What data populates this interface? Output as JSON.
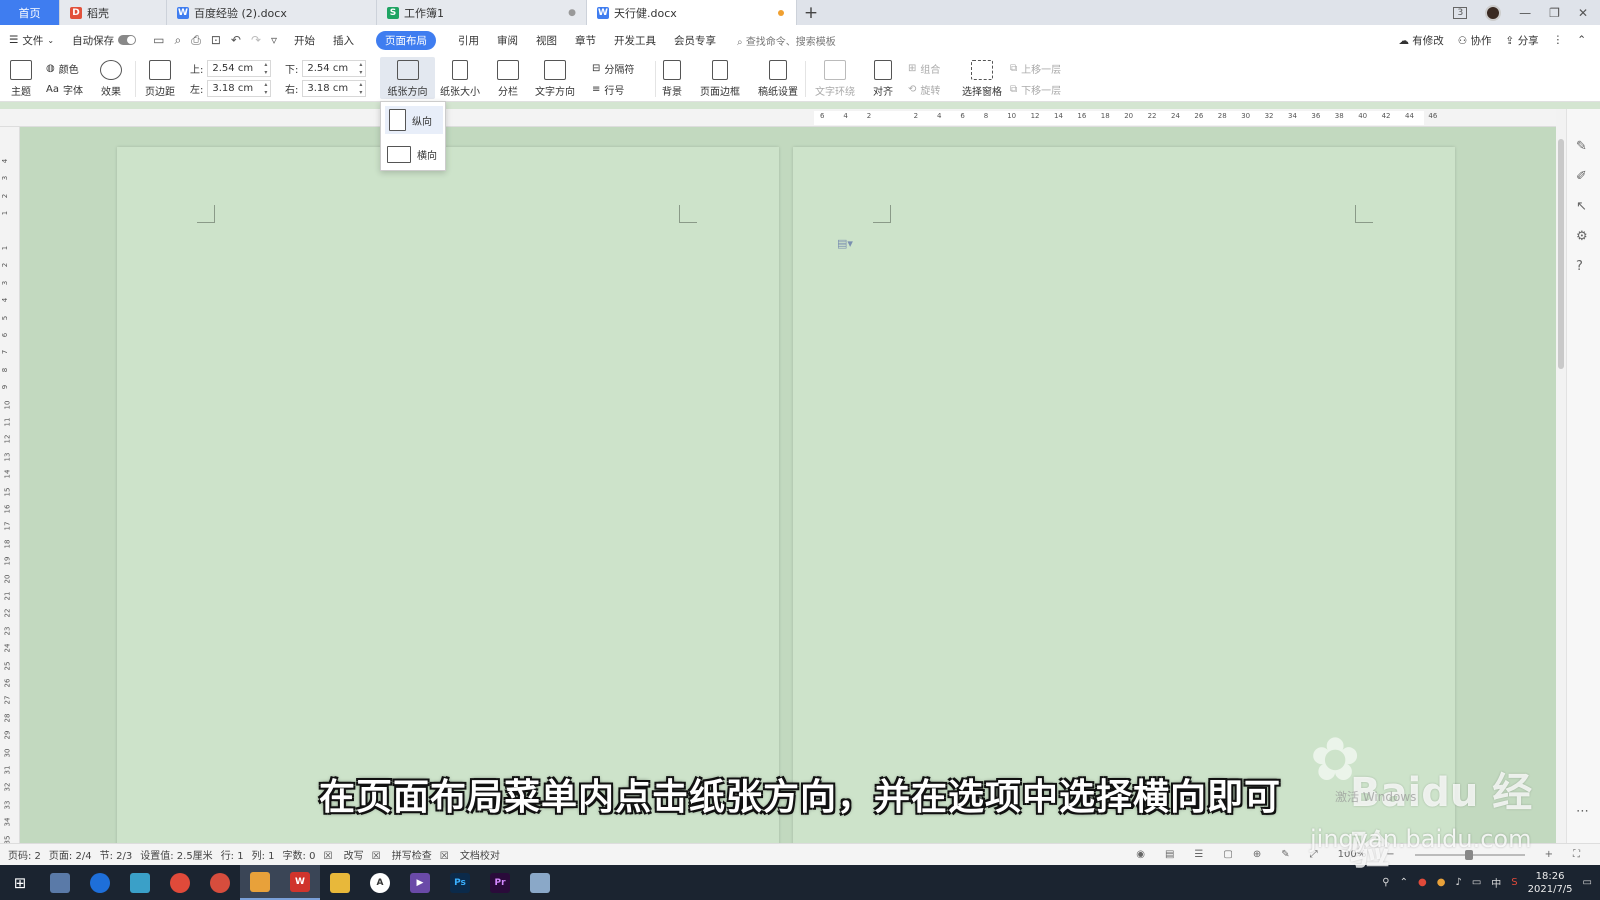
{
  "tabs": [
    {
      "label": "首页"
    },
    {
      "label": "稻壳"
    },
    {
      "label": "百度经验 (2).docx"
    },
    {
      "label": "工作簿1"
    },
    {
      "label": "天行健.docx"
    }
  ],
  "window": {
    "badge": "3"
  },
  "menu": {
    "file": "文件",
    "autosave": "自动保存",
    "items": [
      "开始",
      "插入",
      "页面布局",
      "引用",
      "审阅",
      "视图",
      "章节",
      "开发工具",
      "会员专享"
    ],
    "search_placeholder": "查找命令、搜索模板",
    "right": [
      "有修改",
      "协作",
      "分享"
    ]
  },
  "ribbon": {
    "theme": "主题",
    "color": "颜色",
    "font": "字体",
    "effect": "效果",
    "margins": "页边距",
    "top_label": "上:",
    "top_value": "2.54 cm",
    "bottom_label": "下:",
    "bottom_value": "2.54 cm",
    "left_label": "左:",
    "left_value": "3.18 cm",
    "right_label": "右:",
    "right_value": "3.18 cm",
    "orientation": "纸张方向",
    "size": "纸张大小",
    "columns": "分栏",
    "text_direction": "文字方向",
    "breaks": "分隔符",
    "line_numbers": "行号",
    "background": "背景",
    "page_border": "页面边框",
    "draft_settings": "稿纸设置",
    "wrap_text": "文字环绕",
    "align": "对齐",
    "group": "组合",
    "rotate": "旋转",
    "selection_pane": "选择窗格",
    "bring_forward": "上移一层",
    "send_backward": "下移一层"
  },
  "dropdown": {
    "portrait": "纵向",
    "landscape": "横向"
  },
  "ruler_h": [
    "6",
    "4",
    "2",
    "",
    "2",
    "4",
    "6",
    "8",
    "10",
    "12",
    "14",
    "16",
    "18",
    "20",
    "22",
    "24",
    "26",
    "28",
    "30",
    "32",
    "34",
    "36",
    "38",
    "40",
    "42",
    "44",
    "46"
  ],
  "ruler_v": [
    "4",
    "3",
    "2",
    "1",
    "",
    "1",
    "2",
    "3",
    "4",
    "5",
    "6",
    "7",
    "8",
    "9",
    "10",
    "11",
    "12",
    "13",
    "14",
    "15",
    "16",
    "17",
    "18",
    "19",
    "20",
    "21",
    "22",
    "23",
    "24",
    "25",
    "26",
    "27",
    "28",
    "29",
    "30",
    "31",
    "32",
    "33",
    "34",
    "35"
  ],
  "status": {
    "page_num": "页码: 2",
    "pages": "页面: 2/4",
    "section": "节: 2/3",
    "setting": "设置值: 2.5厘米",
    "row": "行: 1",
    "col": "列: 1",
    "words": "字数: 0",
    "revise": "改写",
    "spell": "拼写检查",
    "proof": "文档校对",
    "zoom": "100%"
  },
  "taskbar": {
    "time": "18:26",
    "date": "2021/7/5",
    "ime": "中"
  },
  "subtitle": "在页面布局菜单内点击纸张方向，并在选项中选择横向即可",
  "watermark": {
    "brand": "Baidu 经验",
    "url": "jingyan.baidu.com",
    "activate": "激活 Windows"
  }
}
